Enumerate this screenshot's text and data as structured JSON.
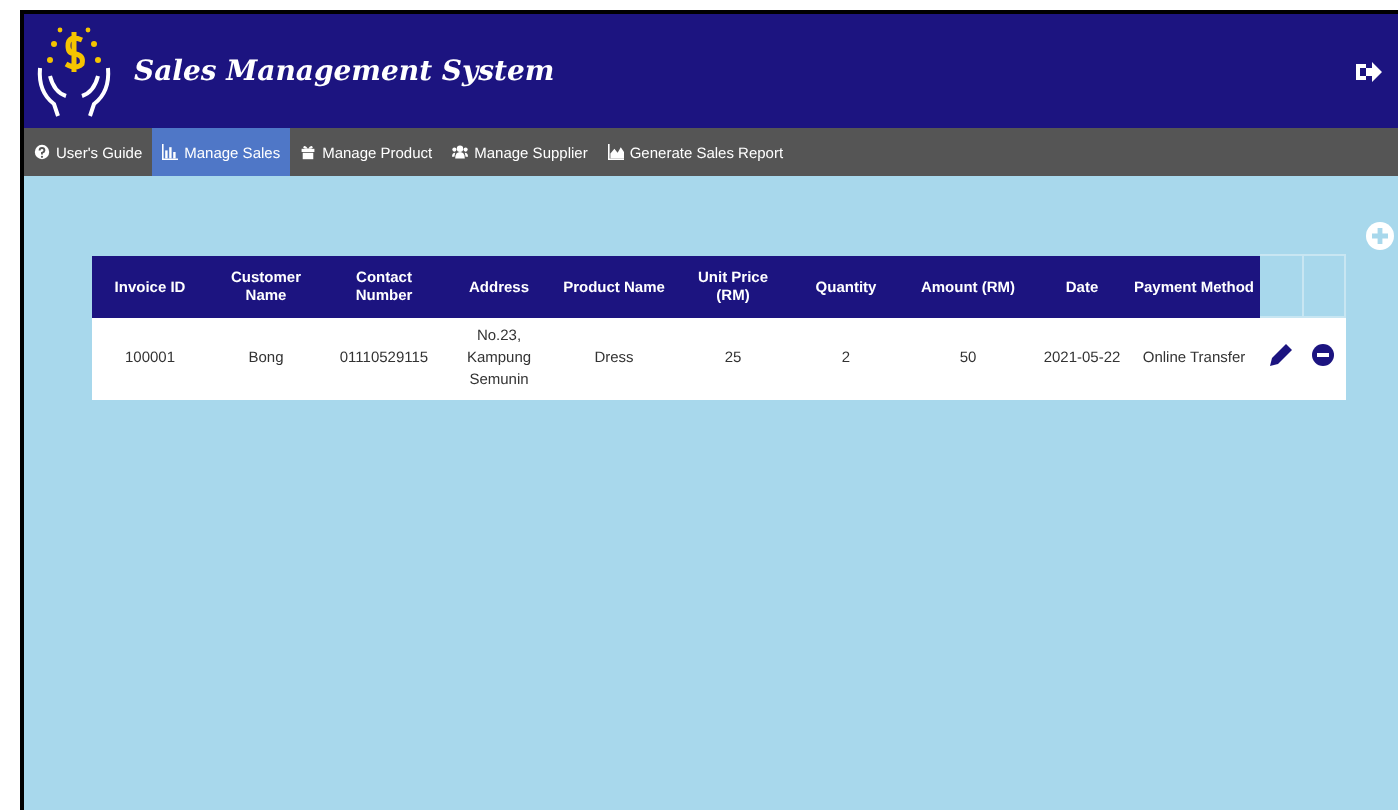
{
  "header": {
    "title": "Sales Management System"
  },
  "nav": [
    {
      "label": "User's Guide",
      "selected": false
    },
    {
      "label": "Manage Sales",
      "selected": true
    },
    {
      "label": "Manage Product",
      "selected": false
    },
    {
      "label": "Manage Supplier",
      "selected": false
    },
    {
      "label": "Generate Sales Report",
      "selected": false
    }
  ],
  "table": {
    "columns": [
      "Invoice ID",
      "Customer Name",
      "Contact Number",
      "Address",
      "Product Name",
      "Unit Price (RM)",
      "Quantity",
      "Amount (RM)",
      "Date",
      "Payment Method"
    ],
    "rows": [
      [
        "100001",
        "Bong",
        "01110529115",
        "No.23, Kampung Semunin",
        "Dress",
        "25",
        "2",
        "50",
        "2021-05-22",
        "Online Transfer"
      ]
    ]
  }
}
